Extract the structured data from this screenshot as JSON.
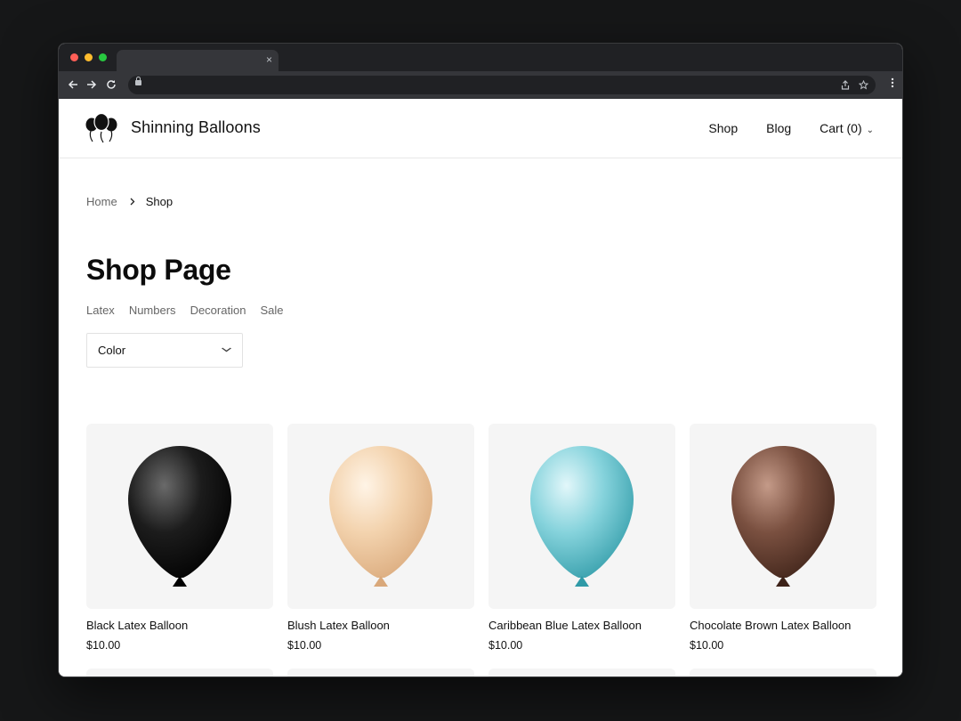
{
  "colors": {
    "traffic_red": "#ff5f57",
    "traffic_yellow": "#febc2e",
    "traffic_green": "#28c840"
  },
  "browser": {
    "tab_close": "×",
    "back_icon": "arrow-left-icon",
    "forward_icon": "arrow-right-icon",
    "reload_icon": "reload-icon"
  },
  "header": {
    "brand": "Shinning Balloons",
    "nav": {
      "shop": "Shop",
      "blog": "Blog",
      "cart": "Cart (0)"
    }
  },
  "breadcrumb": {
    "home": "Home",
    "current": "Shop"
  },
  "page_title": "Shop Page",
  "categories": [
    "Latex",
    "Numbers",
    "Decoration",
    "Sale"
  ],
  "filter": {
    "color_label": "Color"
  },
  "products": [
    {
      "name": "Black Latex Balloon",
      "price": "$10.00",
      "color": "#1c1c1c",
      "highlight": "#6a6a6a",
      "shade": "#000000"
    },
    {
      "name": "Blush Latex Balloon",
      "price": "$10.00",
      "color": "#f3d3ae",
      "highlight": "#fff4e6",
      "shade": "#d9a87a"
    },
    {
      "name": "Caribbean Blue Latex Balloon",
      "price": "$10.00",
      "color": "#86d3dc",
      "highlight": "#e2f7fa",
      "shade": "#2f9aa7"
    },
    {
      "name": "Chocolate Brown Latex Balloon",
      "price": "$10.00",
      "color": "#7a5040",
      "highlight": "#c49a88",
      "shade": "#3d2218"
    }
  ]
}
